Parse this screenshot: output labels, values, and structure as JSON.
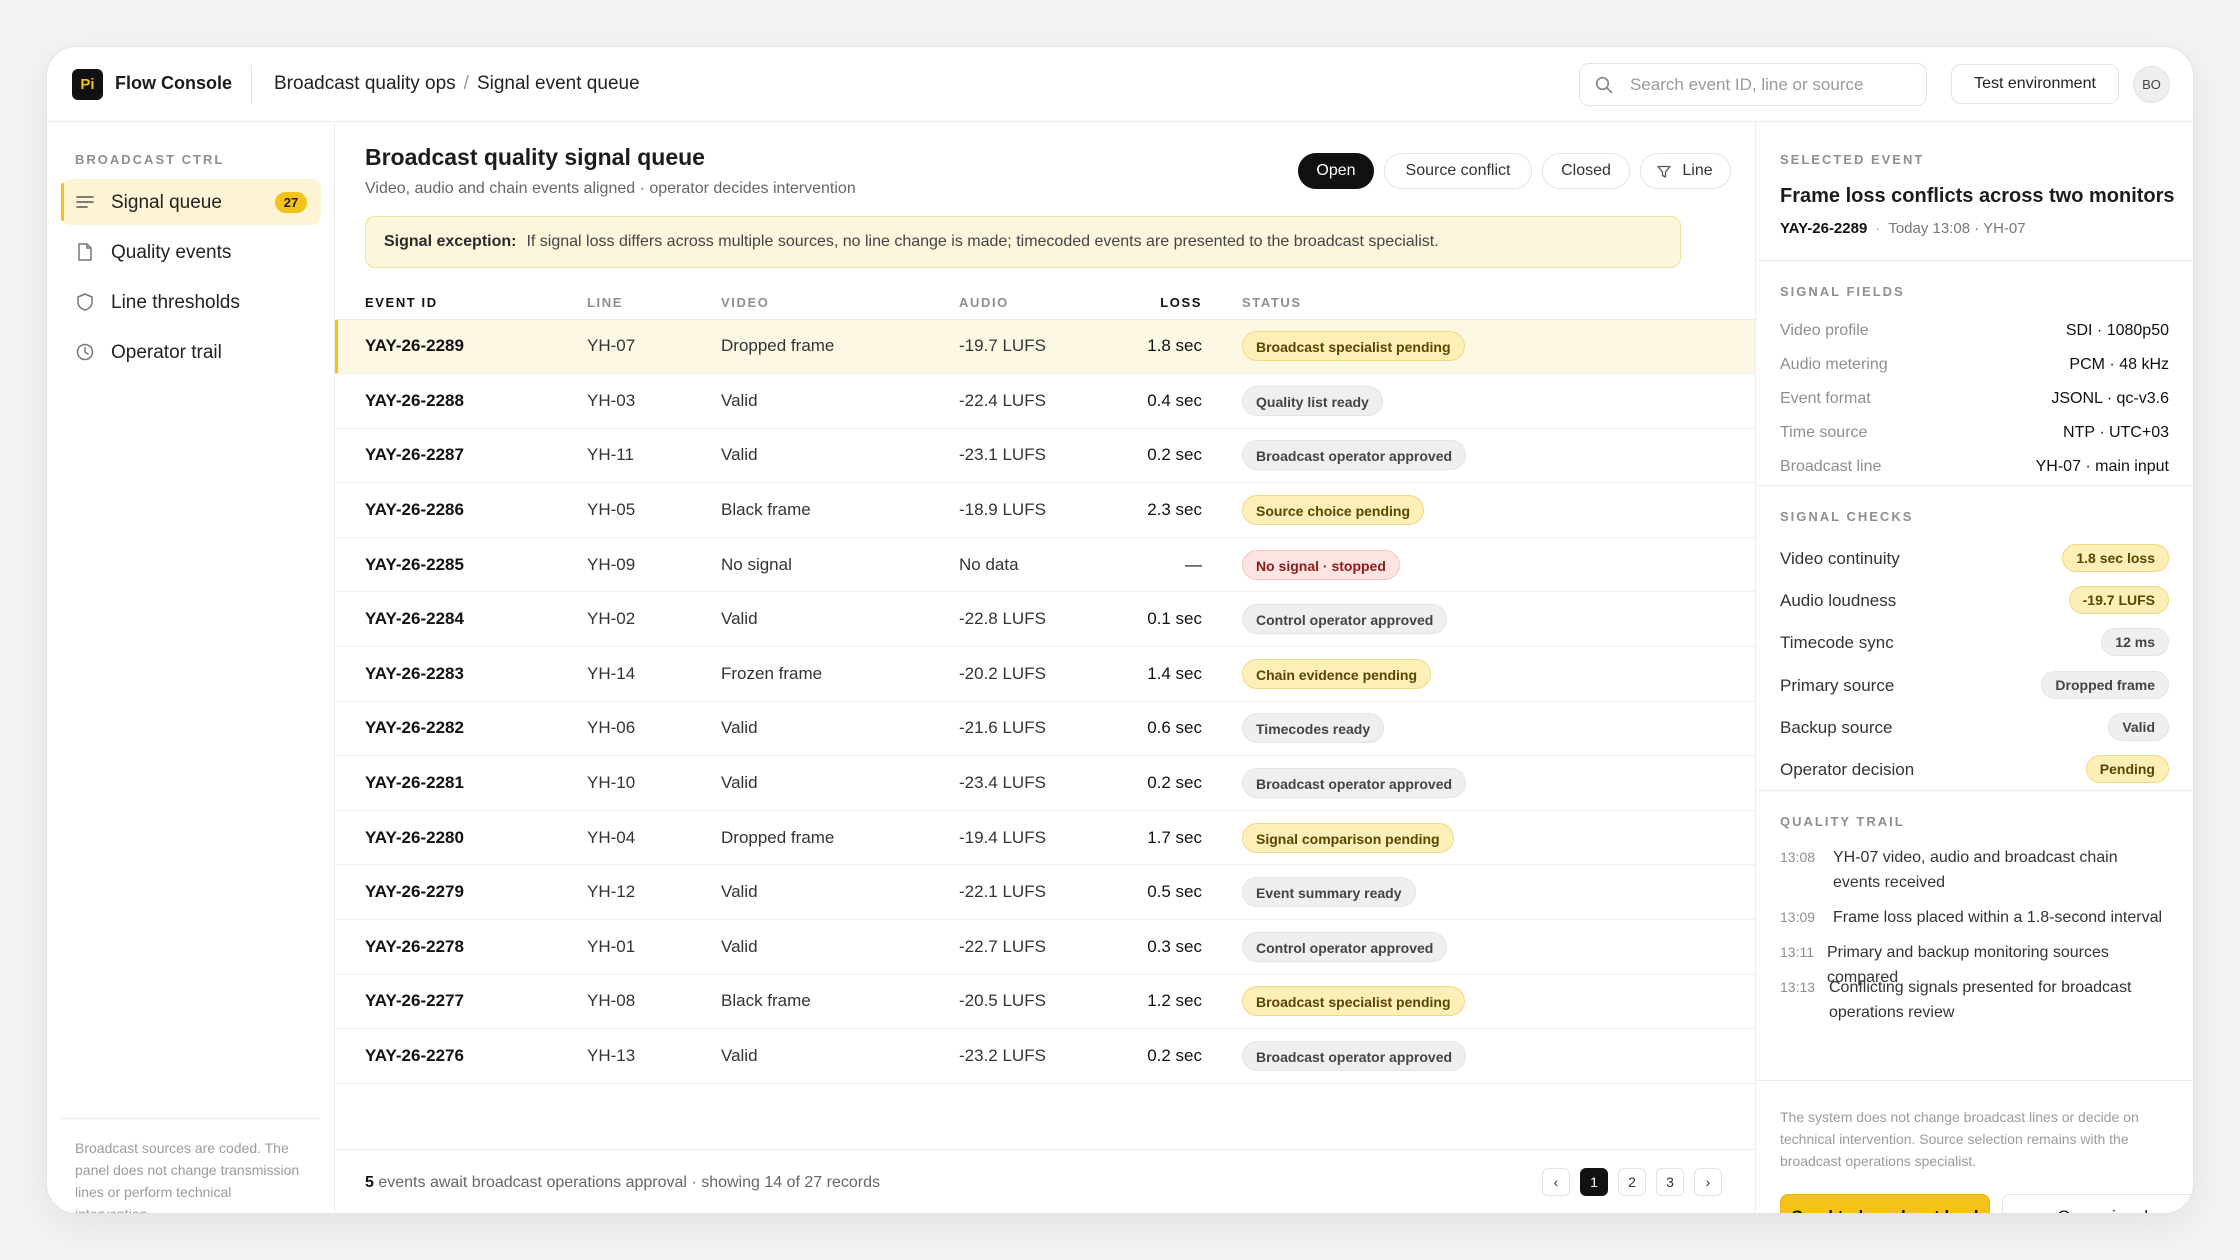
{
  "app": {
    "logo": "Pi",
    "name": "Flow Console"
  },
  "breadcrumb": [
    "Broadcast quality ops",
    "Signal event queue"
  ],
  "search": {
    "placeholder": "Search event ID, line or source",
    "value": ""
  },
  "env_label": "Test environment",
  "user_initials": "BO",
  "sidebar": {
    "section_title": "BROADCAST CTRL",
    "items": [
      {
        "label": "Signal queue",
        "icon": "list-icon",
        "badge": "27",
        "active": true
      },
      {
        "label": "Quality events",
        "icon": "document-icon"
      },
      {
        "label": "Line thresholds",
        "icon": "shield-icon"
      },
      {
        "label": "Operator trail",
        "icon": "clock-icon"
      }
    ],
    "note": "Broadcast sources are coded. The panel does not change transmission lines or perform technical intervention."
  },
  "main": {
    "title": "Broadcast quality signal queue",
    "subtitle": "Video, audio and chain events aligned · operator decides intervention",
    "filters": [
      "Open",
      "Source conflict",
      "Closed",
      "Line"
    ],
    "notice_label": "Signal exception:",
    "notice_text": "If signal loss differs across multiple sources, no line change is made; timecoded events are presented to the broadcast specialist.",
    "columns": [
      "EVENT ID",
      "LINE",
      "VIDEO",
      "AUDIO",
      "LOSS",
      "STATUS"
    ],
    "rows": [
      {
        "id": "YAY-26-2289",
        "line": "YH-07",
        "video": "Dropped frame",
        "audio": "-19.7 LUFS",
        "loss": "1.8 sec",
        "status": "Broadcast specialist pending",
        "tone": "warn"
      },
      {
        "id": "YAY-26-2288",
        "line": "YH-03",
        "video": "Valid",
        "audio": "-22.4 LUFS",
        "loss": "0.4 sec",
        "status": "Quality list ready",
        "tone": "neutral"
      },
      {
        "id": "YAY-26-2287",
        "line": "YH-11",
        "video": "Valid",
        "audio": "-23.1 LUFS",
        "loss": "0.2 sec",
        "status": "Broadcast operator approved",
        "tone": "neutral"
      },
      {
        "id": "YAY-26-2286",
        "line": "YH-05",
        "video": "Black frame",
        "audio": "-18.9 LUFS",
        "loss": "2.3 sec",
        "status": "Source choice pending",
        "tone": "warn"
      },
      {
        "id": "YAY-26-2285",
        "line": "YH-09",
        "video": "No signal",
        "audio": "No data",
        "loss": "—",
        "status": "No signal · stopped",
        "tone": "error"
      },
      {
        "id": "YAY-26-2284",
        "line": "YH-02",
        "video": "Valid",
        "audio": "-22.8 LUFS",
        "loss": "0.1 sec",
        "status": "Control operator approved",
        "tone": "neutral"
      },
      {
        "id": "YAY-26-2283",
        "line": "YH-14",
        "video": "Frozen frame",
        "audio": "-20.2 LUFS",
        "loss": "1.4 sec",
        "status": "Chain evidence pending",
        "tone": "warn"
      },
      {
        "id": "YAY-26-2282",
        "line": "YH-06",
        "video": "Valid",
        "audio": "-21.6 LUFS",
        "loss": "0.6 sec",
        "status": "Timecodes ready",
        "tone": "neutral"
      },
      {
        "id": "YAY-26-2281",
        "line": "YH-10",
        "video": "Valid",
        "audio": "-23.4 LUFS",
        "loss": "0.2 sec",
        "status": "Broadcast operator approved",
        "tone": "neutral"
      },
      {
        "id": "YAY-26-2280",
        "line": "YH-04",
        "video": "Dropped frame",
        "audio": "-19.4 LUFS",
        "loss": "1.7 sec",
        "status": "Signal comparison pending",
        "tone": "warn"
      },
      {
        "id": "YAY-26-2279",
        "line": "YH-12",
        "video": "Valid",
        "audio": "-22.1 LUFS",
        "loss": "0.5 sec",
        "status": "Event summary ready",
        "tone": "neutral"
      },
      {
        "id": "YAY-26-2278",
        "line": "YH-01",
        "video": "Valid",
        "audio": "-22.7 LUFS",
        "loss": "0.3 sec",
        "status": "Control operator approved",
        "tone": "neutral"
      },
      {
        "id": "YAY-26-2277",
        "line": "YH-08",
        "video": "Black frame",
        "audio": "-20.5 LUFS",
        "loss": "1.2 sec",
        "status": "Broadcast specialist pending",
        "tone": "warn"
      },
      {
        "id": "YAY-26-2276",
        "line": "YH-13",
        "video": "Valid",
        "audio": "-23.2 LUFS",
        "loss": "0.2 sec",
        "status": "Broadcast operator approved",
        "tone": "neutral"
      }
    ],
    "footer_count": "5",
    "footer_text": " events await broadcast operations approval · showing 14 of 27 records",
    "pagination": {
      "prev": "‹",
      "pages": [
        "1",
        "2",
        "3"
      ],
      "current": "1",
      "next": "›"
    }
  },
  "detail": {
    "label": "SELECTED EVENT",
    "title": "Frame loss conflicts across two monitors",
    "event_id": "YAY-26-2289",
    "meta": "Today 13:08 · YH-07",
    "fields_label": "SIGNAL FIELDS",
    "fields": [
      {
        "k": "Video profile",
        "v": "SDI · 1080p50"
      },
      {
        "k": "Audio metering",
        "v": "PCM · 48 kHz"
      },
      {
        "k": "Event format",
        "v": "JSONL · qc-v3.6"
      },
      {
        "k": "Time source",
        "v": "NTP · UTC+03"
      },
      {
        "k": "Broadcast line",
        "v": "YH-07 · main input"
      }
    ],
    "checks_label": "SIGNAL CHECKS",
    "checks": [
      {
        "k": "Video continuity",
        "v": "1.8 sec loss",
        "tone": "warn"
      },
      {
        "k": "Audio loudness",
        "v": "-19.7 LUFS",
        "tone": "warn"
      },
      {
        "k": "Timecode sync",
        "v": "12 ms",
        "tone": "neutral"
      },
      {
        "k": "Primary source",
        "v": "Dropped frame",
        "tone": "neutral"
      },
      {
        "k": "Backup source",
        "v": "Valid",
        "tone": "neutral"
      },
      {
        "k": "Operator decision",
        "v": "Pending",
        "tone": "warn"
      }
    ],
    "trail_label": "QUALITY TRAIL",
    "trail": [
      {
        "t": "13:08",
        "m": "YH-07 video, audio and broadcast chain events received"
      },
      {
        "t": "13:09",
        "m": "Frame loss placed within a 1.8-second interval"
      },
      {
        "t": "13:11",
        "m": "Primary and backup monitoring sources compared"
      },
      {
        "t": "13:13",
        "m": "Conflicting signals presented for broadcast operations review"
      }
    ],
    "note": "The system does not change broadcast lines or decide on technical intervention. Source selection remains with the broadcast operations specialist.",
    "primary_btn": "Send to broadcast lead",
    "secondary_btn": "Open signals"
  }
}
